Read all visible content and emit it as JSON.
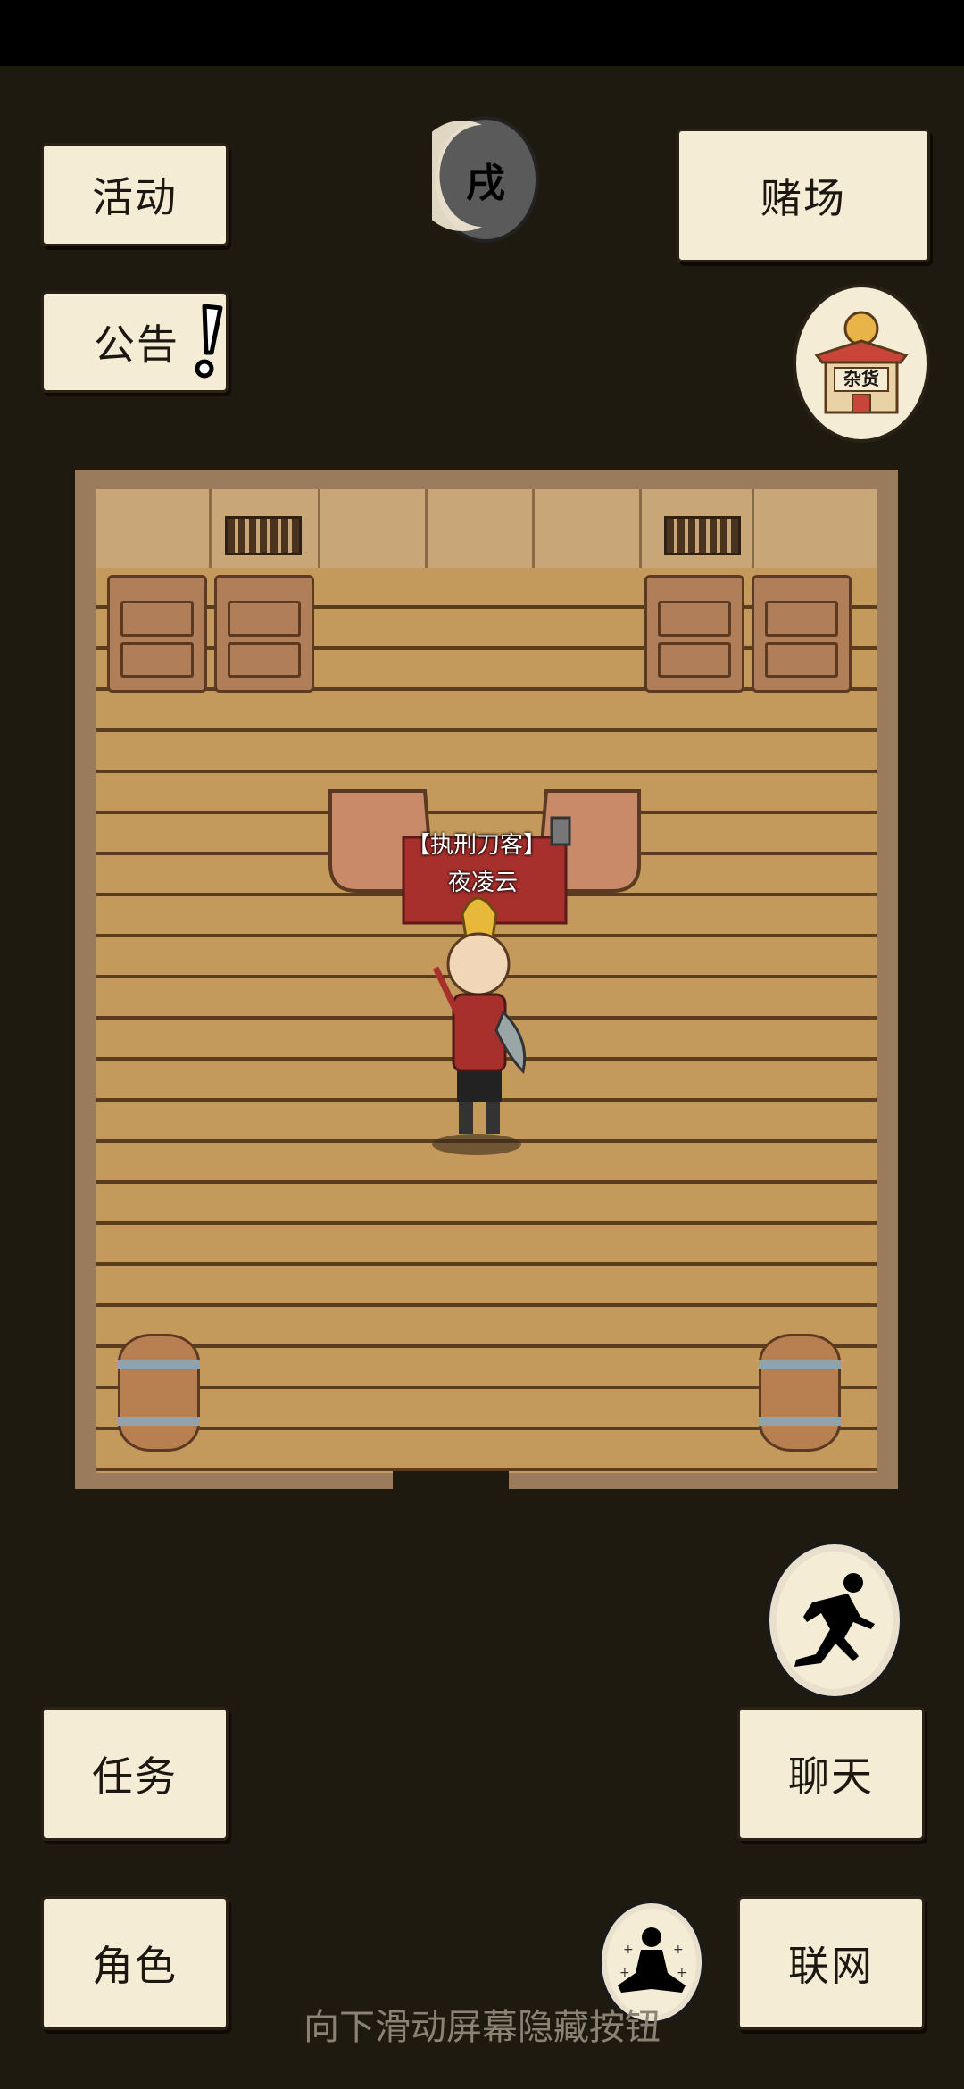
{
  "buttons": {
    "activity": "活动",
    "announcement": "公告",
    "casino": "赌场",
    "quest": "任务",
    "character": "角色",
    "chat": "聊天",
    "online": "联网"
  },
  "time_badge": "戌",
  "shop_sign": "杂货",
  "npc": {
    "title": "【执刑刀客】",
    "name": "夜凌云"
  },
  "hint": "向下滑动屏幕隐藏按钮",
  "colors": {
    "background": "#1f1a0f",
    "paper": "#f5ecd6",
    "floor": "#c49a5c"
  },
  "icons": [
    "exclamation-icon",
    "moon-time-icon",
    "shop-icon",
    "run-icon",
    "meditate-icon"
  ]
}
